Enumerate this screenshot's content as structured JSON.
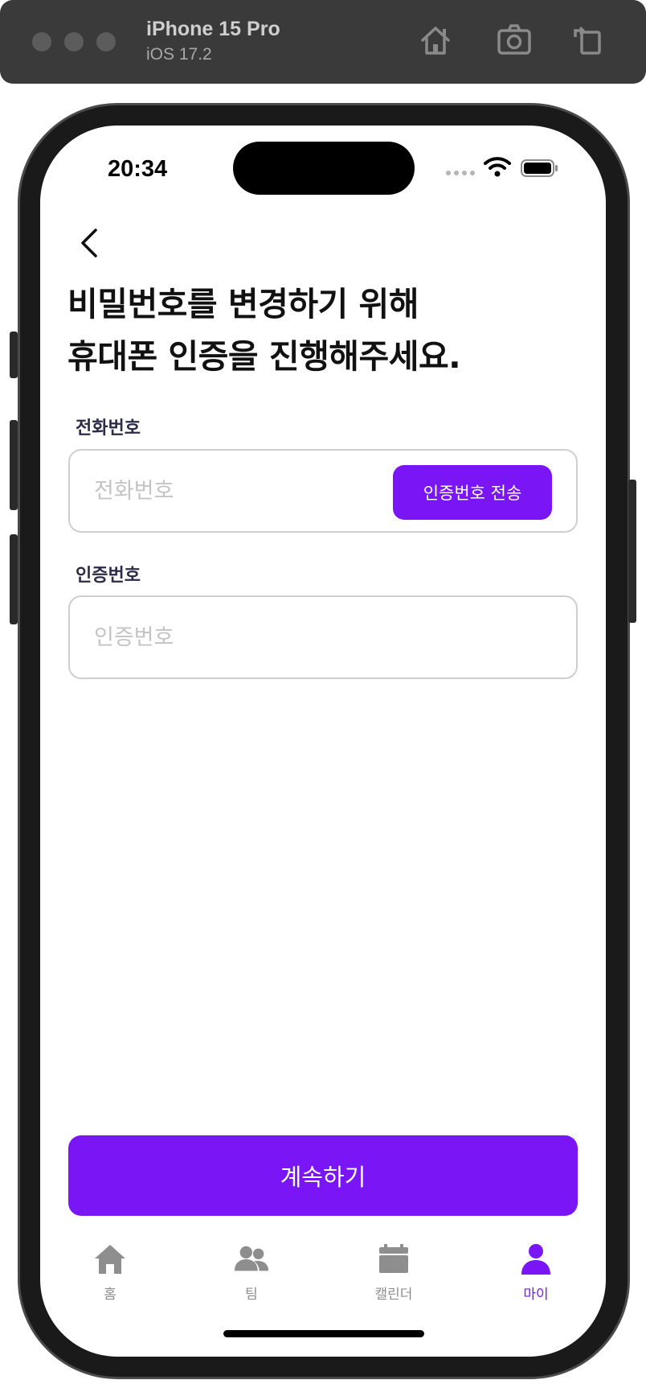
{
  "simulator": {
    "device_name": "iPhone 15 Pro",
    "os_version": "iOS 17.2",
    "toolbar_icons": [
      "home-icon",
      "screenshot-icon",
      "rotate-icon"
    ]
  },
  "status_bar": {
    "time": "20:34",
    "icons": [
      "cellular-dots-icon",
      "wifi-icon",
      "battery-icon"
    ]
  },
  "screen": {
    "heading_line1": "비밀번호를 변경하기 위해",
    "heading_line2": "휴대폰 인증을 진행해주세요.",
    "phone_field": {
      "label": "전화번호",
      "placeholder": "전화번호",
      "value": "",
      "send_button_label": "인증번호 전송"
    },
    "code_field": {
      "label": "인증번호",
      "placeholder": "인증번호",
      "value": ""
    },
    "continue_button_label": "계속하기"
  },
  "tab_bar": {
    "items": [
      {
        "label": "홈",
        "icon": "house-icon",
        "active": false
      },
      {
        "label": "팀",
        "icon": "people-icon",
        "active": false
      },
      {
        "label": "캘린더",
        "icon": "calendar-icon",
        "active": false
      },
      {
        "label": "마이",
        "icon": "person-icon",
        "active": true
      }
    ],
    "active_color": "#7A16F5",
    "inactive_color": "#8E8E8E"
  },
  "colors": {
    "primary": "#7A16F5",
    "label": "#2C2B4A",
    "input_border": "#CFCFCF",
    "placeholder": "#C4C4C4"
  }
}
